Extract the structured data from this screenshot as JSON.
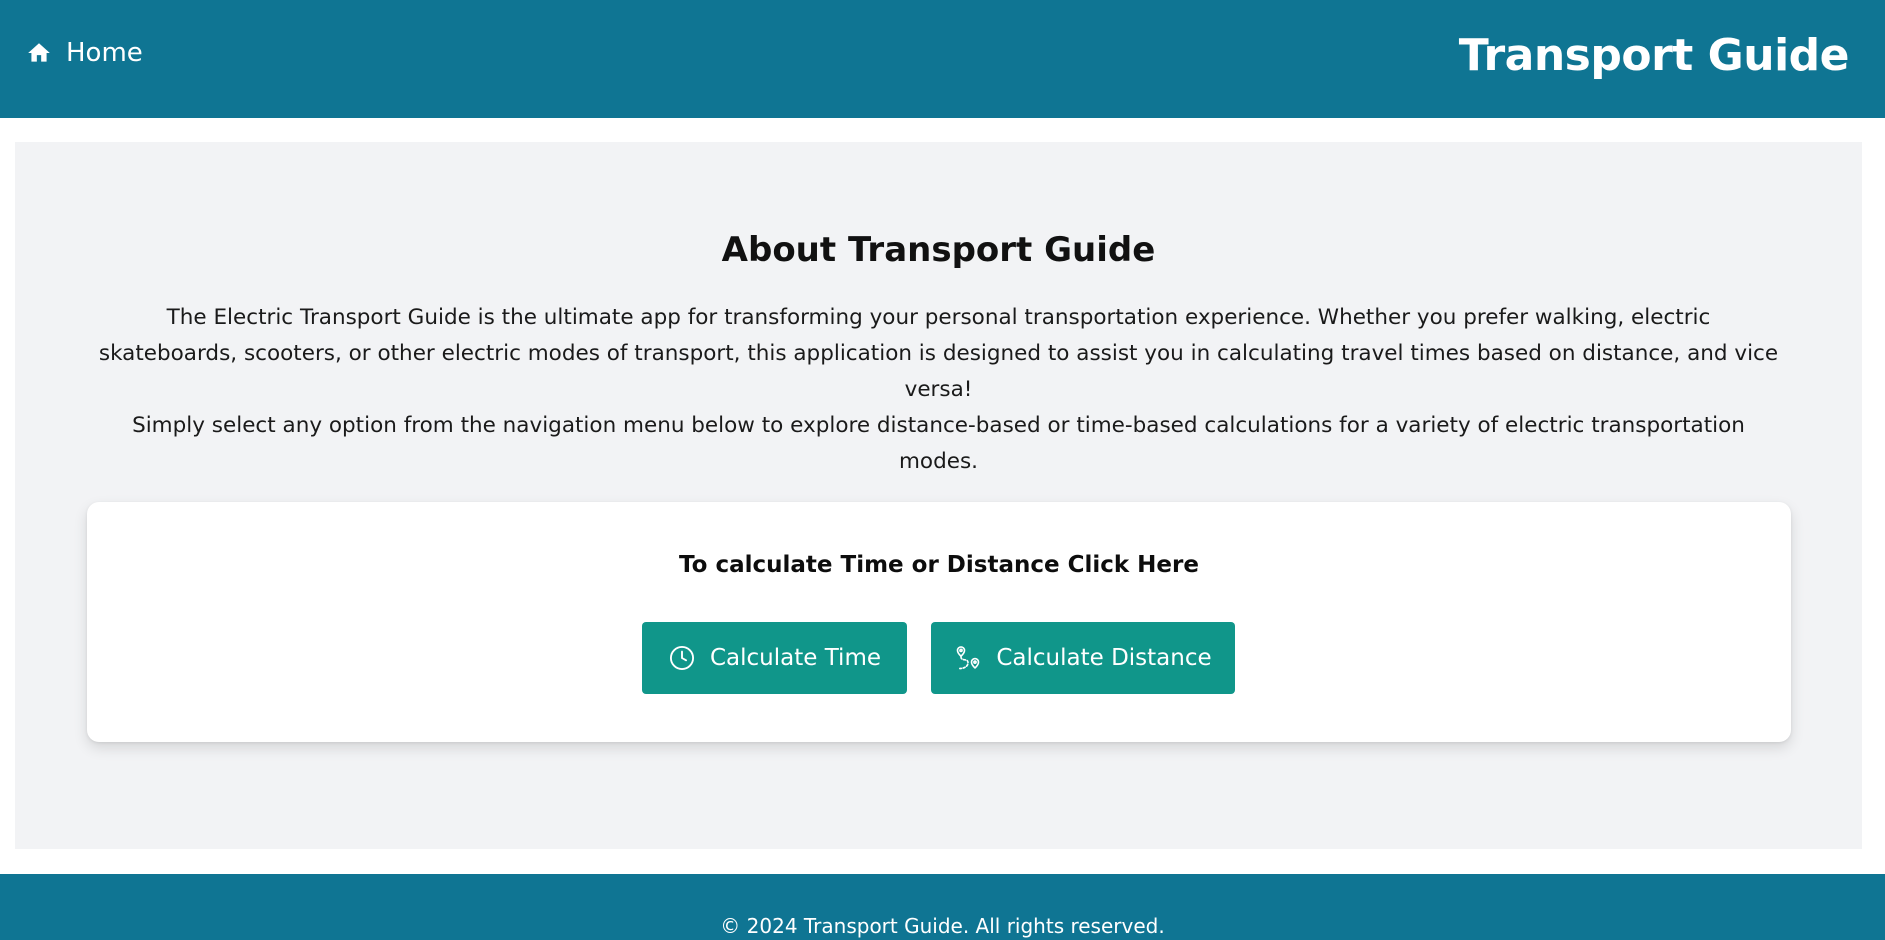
{
  "header": {
    "home_label": "Home",
    "brand_title": "Transport Guide",
    "home_icon": "home-icon",
    "background_color": "#0f7593"
  },
  "about": {
    "title": "About Transport Guide",
    "paragraph_1": "The Electric Transport Guide is the ultimate app for transforming your personal transportation experience. Whether you prefer walking, electric skateboards, scooters, or other electric modes of transport, this application is designed to assist you in calculating travel times based on distance, and vice versa!",
    "paragraph_2": "Simply select any option from the navigation menu below to explore distance-based or time-based calculations for a variety of electric transportation modes."
  },
  "cta_card": {
    "heading": "To calculate Time or Distance Click Here",
    "buttons": [
      {
        "label": "Calculate Time",
        "icon": "clock-icon"
      },
      {
        "label": "Calculate Distance",
        "icon": "route-icon"
      }
    ],
    "button_color": "#10968a"
  },
  "footer": {
    "text": "© 2024 Transport Guide. All rights reserved."
  }
}
